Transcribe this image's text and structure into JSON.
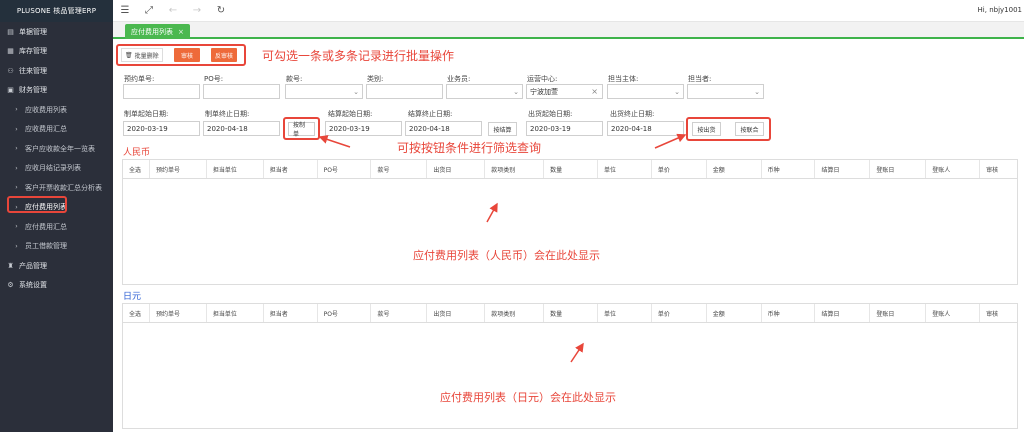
{
  "brand": "PLUSONE 核品管理ERP",
  "sidebar": {
    "items": [
      {
        "label": "单据管理",
        "icon": "document-icon",
        "level": 0
      },
      {
        "label": "库存管理",
        "icon": "warehouse-icon",
        "level": 0
      },
      {
        "label": "往来管理",
        "icon": "contacts-icon",
        "level": 0
      },
      {
        "label": "财务管理",
        "icon": "finance-icon",
        "level": 0
      },
      {
        "label": "应收费用列表",
        "icon": "chevron-right-icon",
        "level": 1
      },
      {
        "label": "应收费用汇总",
        "icon": "chevron-right-icon",
        "level": 1
      },
      {
        "label": "客户应收款全年一览表",
        "icon": "chevron-right-icon",
        "level": 1
      },
      {
        "label": "应收月结记录列表",
        "icon": "chevron-right-icon",
        "level": 1
      },
      {
        "label": "客户开票收款汇总分析表",
        "icon": "chevron-right-icon",
        "level": 1
      },
      {
        "label": "应付费用列表",
        "icon": "chevron-right-icon",
        "level": 1,
        "active": true
      },
      {
        "label": "应付费用汇总",
        "icon": "chevron-right-icon",
        "level": 1
      },
      {
        "label": "员工借款管理",
        "icon": "chevron-right-icon",
        "level": 1
      },
      {
        "label": "产品管理",
        "icon": "product-icon",
        "level": 0
      },
      {
        "label": "系统设置",
        "icon": "gear-icon",
        "level": 0
      }
    ]
  },
  "topbar": {
    "user": "Hi, nbjy1001"
  },
  "tab": {
    "label": "应付费用列表"
  },
  "actions": {
    "delete": "批量删除",
    "audit": "审核",
    "unaudit": "反审核"
  },
  "annotations": {
    "batch": "可勾选一条或多条记录进行批量操作",
    "filter": "可按按钮条件进行筛选查询",
    "rmb_empty": "应付费用列表（人民币）会在此处显示",
    "jpy_empty": "应付费用列表（日元）会在此处显示"
  },
  "filters": {
    "row1": [
      {
        "label": "预约单号:",
        "value": ""
      },
      {
        "label": "PO号:",
        "value": ""
      },
      {
        "label": "款号:",
        "value": "",
        "select": true
      },
      {
        "label": "类别:",
        "value": ""
      },
      {
        "label": "业务员:",
        "value": "",
        "select": true
      },
      {
        "label": "运营中心:",
        "value": "宁波加萱",
        "select": true
      },
      {
        "label": "担当主体:",
        "value": "",
        "select": true
      },
      {
        "label": "担当者:",
        "value": "",
        "select": true
      }
    ],
    "row2": {
      "make_start_label": "制单起始日期:",
      "make_start": "2020-03-19",
      "make_end_label": "制单终止日期:",
      "make_end": "2020-04-18",
      "btn_make": "按制单",
      "settle_start_label": "结算起始日期:",
      "settle_start": "2020-03-19",
      "settle_end_label": "结算终止日期:",
      "settle_end": "2020-04-18",
      "btn_settle": "按结算",
      "ship_start_label": "出货起始日期:",
      "ship_start": "2020-03-19",
      "ship_end_label": "出货终止日期:",
      "ship_end": "2020-04-18",
      "btn_ship": "按出货",
      "btn_post": "按联合"
    }
  },
  "sections": {
    "rmb": "人民币",
    "jpy": "日元"
  },
  "columns": [
    "全选",
    "预约单号",
    "担当单位",
    "担当者",
    "PO号",
    "款号",
    "出货日",
    "款项类别",
    "数量",
    "单位",
    "单价",
    "金额",
    "币种",
    "结算日",
    "登账日",
    "登账人",
    "审核"
  ],
  "colors": {
    "accent": "#4bb84f",
    "danger": "#e8463a",
    "orange": "#ee6a3a",
    "blue": "#2d5fd4",
    "sidebar": "#2b2f3a"
  }
}
